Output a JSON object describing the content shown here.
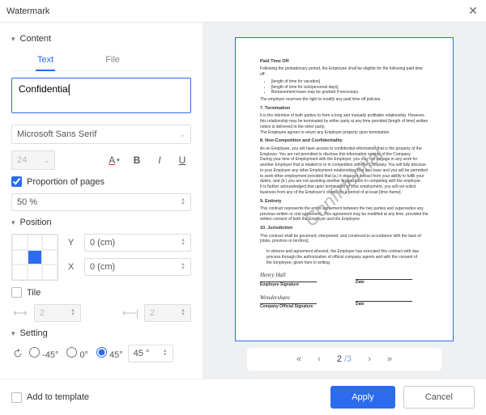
{
  "titlebar": {
    "title": "Watermark"
  },
  "section": {
    "content": "Content",
    "position": "Position",
    "setting": "Setting"
  },
  "tabs": {
    "text": "Text",
    "file": "File"
  },
  "content": {
    "watermark_text": "Confidential",
    "font": "Microsoft Sans Serif",
    "font_size": "24",
    "proportion_label": "Proportion of pages",
    "proportion_value": "50 %"
  },
  "position": {
    "y_label": "Y",
    "y_value": "0 (cm)",
    "x_label": "X",
    "x_value": "0 (cm)",
    "tile_label": "Tile",
    "tile_h": "2",
    "tile_v": "2"
  },
  "setting": {
    "neg45": "-45°",
    "zero": "0°",
    "pos45": "45°",
    "angle_value": "45 °"
  },
  "pager": {
    "current": "2",
    "total": "/3"
  },
  "footer": {
    "add_template": "Add to template",
    "apply": "Apply",
    "cancel": "Cancel"
  },
  "doc": {
    "h1": "Paid Time Off",
    "p1": "Following the probationary period, the Employee shall be eligible for the following paid time off:",
    "li1": "[length of time for vacation]",
    "li2": "[length of time for sick/personal days]",
    "li3": "Bereavement leave may be granted if necessary.",
    "p2": "The employer reserves the right to modify any paid time off policies.",
    "h2": "7.  Termination",
    "p3": "It is the intention of both parties to form a long and mutually profitable relationship. However, this relationship may be terminated by either party at any time provided [length of time] written notice is delivered to the other party.",
    "p4": "The Employee agrees to return any Employer property upon termination.",
    "h3": "8.  Non-Competition and Confidentiality",
    "p5": "As an Employee, you will have access to confidential information that is the property of the Employer. You are not permitted to disclose this information outside of the Company.",
    "p6": "During your time of Employment with the Employer, you may not engage in any work for another Employer that is related to or in competition with the Company. You will fully disclose to your Employer any other Employment relationships that you have and you will be permitted to seek other employment provided that (a.) it does not detract from your ability to fulfill your duties, and (b.) you are not assisting another organization in competing with the employer.",
    "p7": "It is further acknowledged that upon termination of your employment, you will not solicit business from any of the Employer's clients for a period of at least [time frame].",
    "h4": "9.  Entirety",
    "p8": "This contract represents the entire agreement between the two parties and supersedes any previous written or oral agreement. This agreement may be modified at any time, provided the written consent of both the Employer and the Employee.",
    "h5": "10. Jurisdiction",
    "p9": "This contract shall be governed, interpreted, and construed in accordance with the laws of [state, province or territory].",
    "p10": "In witness and agreement whereof, the Employer has executed this contract with due process through the authorization of official company agents and with the consent of the Employee, given here in writing.",
    "sig1_name": "Henry Hall",
    "sig1_label": "Employee Signature",
    "sig2_name": "Wondershare",
    "sig2_label": "Company Official Signature",
    "date_label": "Date",
    "watermark": "Confidential"
  }
}
